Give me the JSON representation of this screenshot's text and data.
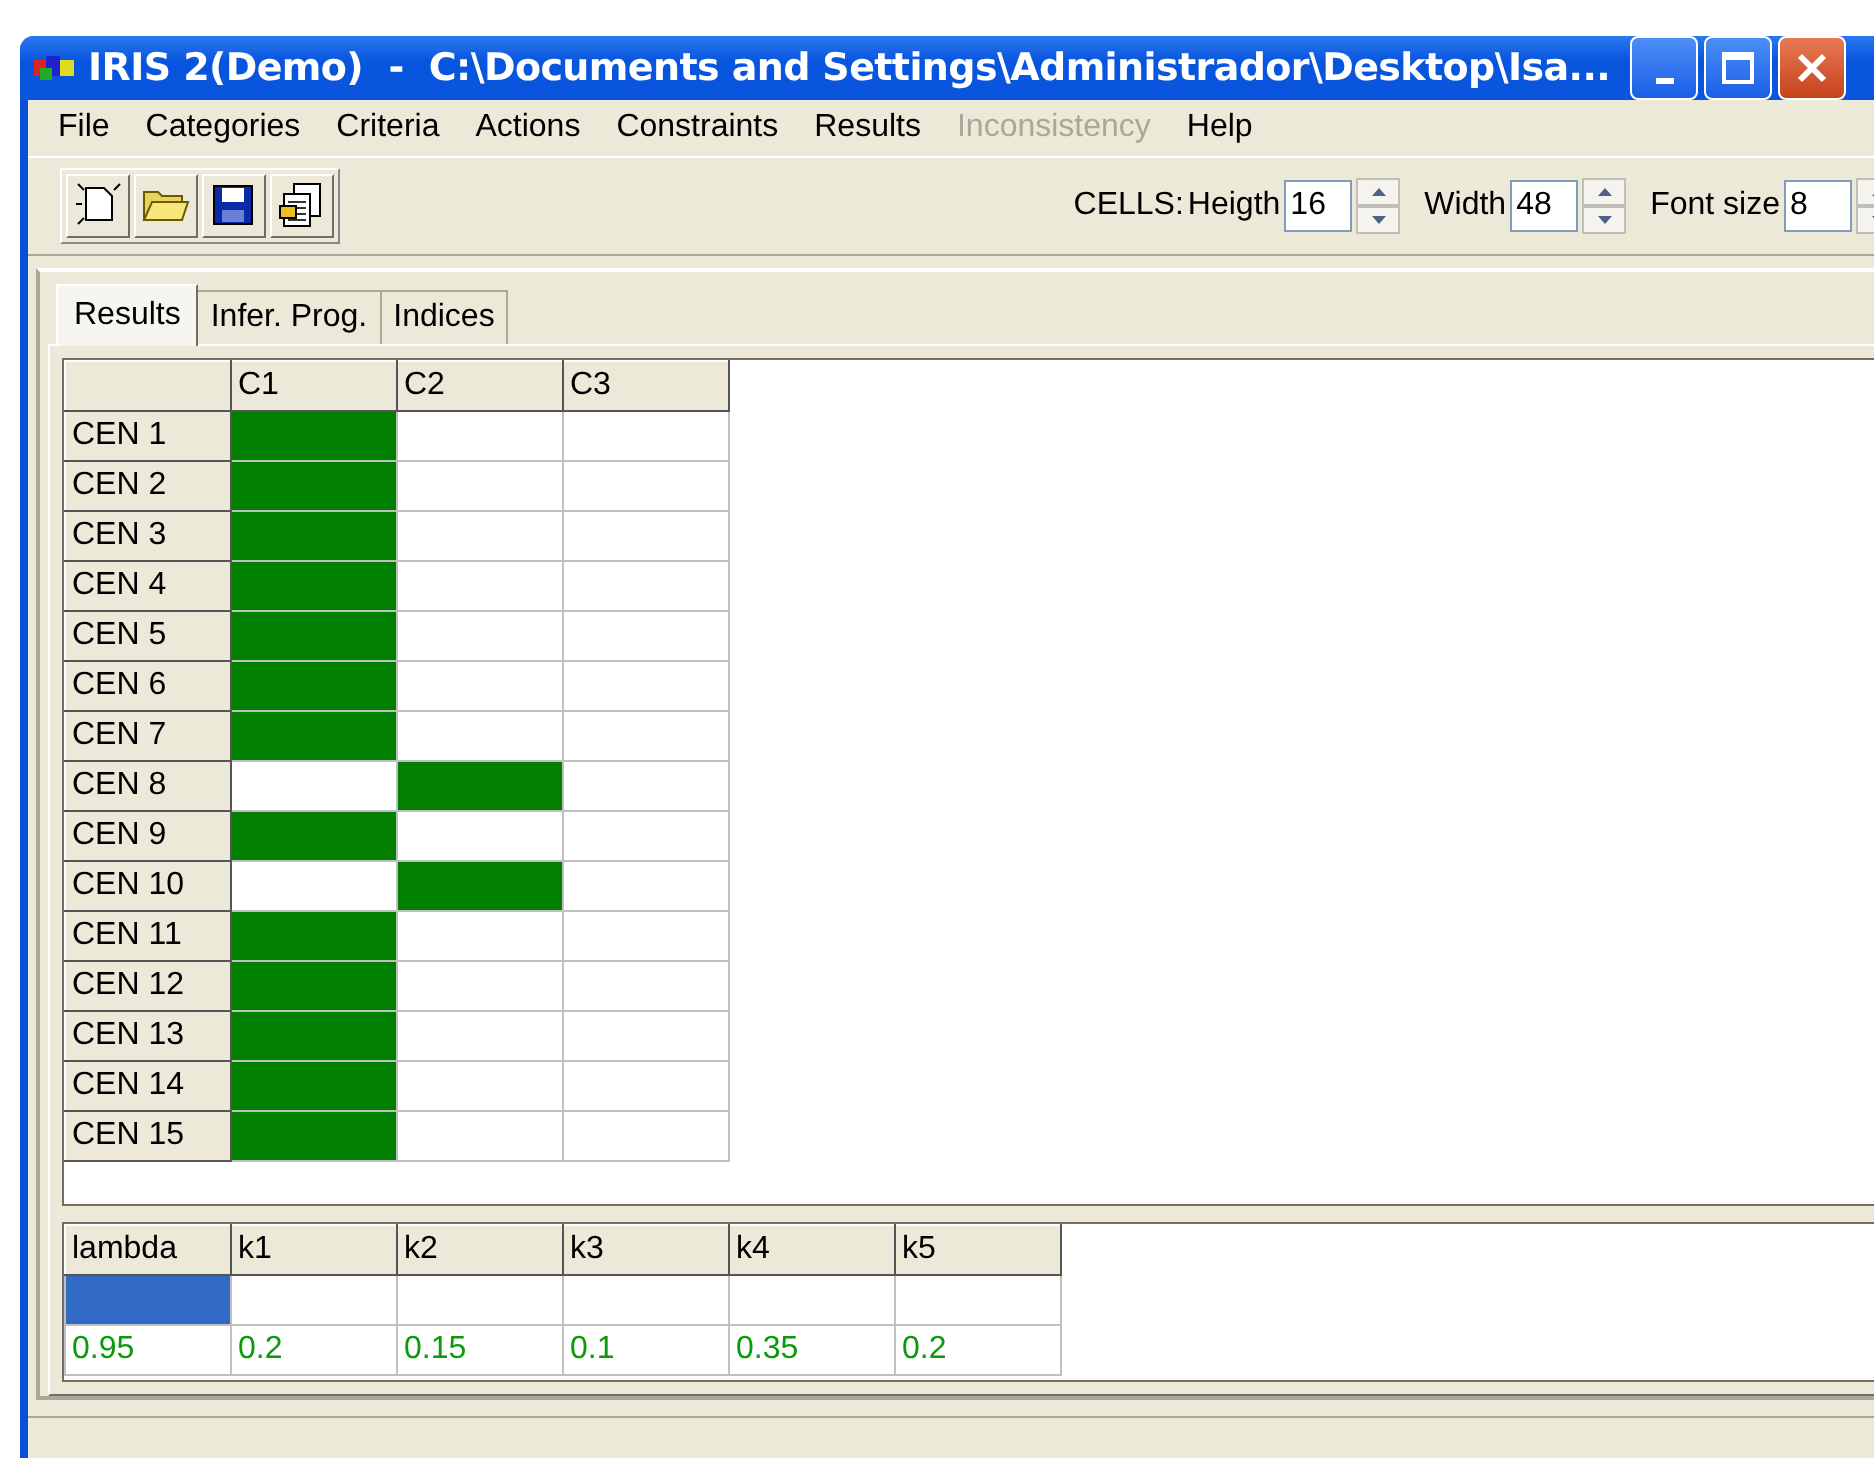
{
  "window": {
    "title": "IRIS 2(Demo)  -  C:\\Documents and Settings\\Administrador\\Desktop\\Isa..."
  },
  "menu": [
    {
      "label": "File",
      "disabled": false
    },
    {
      "label": "Categories",
      "disabled": false
    },
    {
      "label": "Criteria",
      "disabled": false
    },
    {
      "label": "Actions",
      "disabled": false
    },
    {
      "label": "Constraints",
      "disabled": false
    },
    {
      "label": "Results",
      "disabled": false
    },
    {
      "label": "Inconsistency",
      "disabled": true
    },
    {
      "label": "Help",
      "disabled": false
    }
  ],
  "toolbar": {
    "buttons": [
      {
        "kind": "new"
      },
      {
        "kind": "open"
      },
      {
        "kind": "save"
      },
      {
        "kind": "report"
      }
    ],
    "cells_label": "CELLS:",
    "fields": [
      {
        "label": "Heigth",
        "value": "16"
      },
      {
        "label": "Width",
        "value": "48"
      },
      {
        "label": "Font size",
        "value": "8"
      }
    ]
  },
  "tabs": [
    {
      "label": "Results",
      "selected": true
    },
    {
      "label": "Infer. Prog.",
      "selected": false
    },
    {
      "label": "Indices",
      "selected": false
    }
  ],
  "results": {
    "columns": [
      "C1",
      "C2",
      "C3"
    ],
    "rows": [
      {
        "label": "CEN 1",
        "cells": [
          true,
          false,
          false
        ]
      },
      {
        "label": "CEN 2",
        "cells": [
          true,
          false,
          false
        ]
      },
      {
        "label": "CEN 3",
        "cells": [
          true,
          false,
          false
        ]
      },
      {
        "label": "CEN 4",
        "cells": [
          true,
          false,
          false
        ]
      },
      {
        "label": "CEN 5",
        "cells": [
          true,
          false,
          false
        ]
      },
      {
        "label": "CEN 6",
        "cells": [
          true,
          false,
          false
        ]
      },
      {
        "label": "CEN 7",
        "cells": [
          true,
          false,
          false
        ]
      },
      {
        "label": "CEN 8",
        "cells": [
          false,
          true,
          false
        ]
      },
      {
        "label": "CEN 9",
        "cells": [
          true,
          false,
          false
        ]
      },
      {
        "label": "CEN 10",
        "cells": [
          false,
          true,
          false
        ]
      },
      {
        "label": "CEN 11",
        "cells": [
          true,
          false,
          false
        ]
      },
      {
        "label": "CEN 12",
        "cells": [
          true,
          false,
          false
        ]
      },
      {
        "label": "CEN 13",
        "cells": [
          true,
          false,
          false
        ]
      },
      {
        "label": "CEN 14",
        "cells": [
          true,
          false,
          false
        ]
      },
      {
        "label": "CEN 15",
        "cells": [
          true,
          false,
          false
        ]
      }
    ]
  },
  "parameters": [
    {
      "name": "lambda",
      "selected": true,
      "value": "0.95"
    },
    {
      "name": "k1",
      "selected": false,
      "value": "0.2"
    },
    {
      "name": "k2",
      "selected": false,
      "value": "0.15"
    },
    {
      "name": "k3",
      "selected": false,
      "value": "0.1"
    },
    {
      "name": "k4",
      "selected": false,
      "value": "0.35"
    },
    {
      "name": "k5",
      "selected": false,
      "value": "0.2"
    }
  ]
}
